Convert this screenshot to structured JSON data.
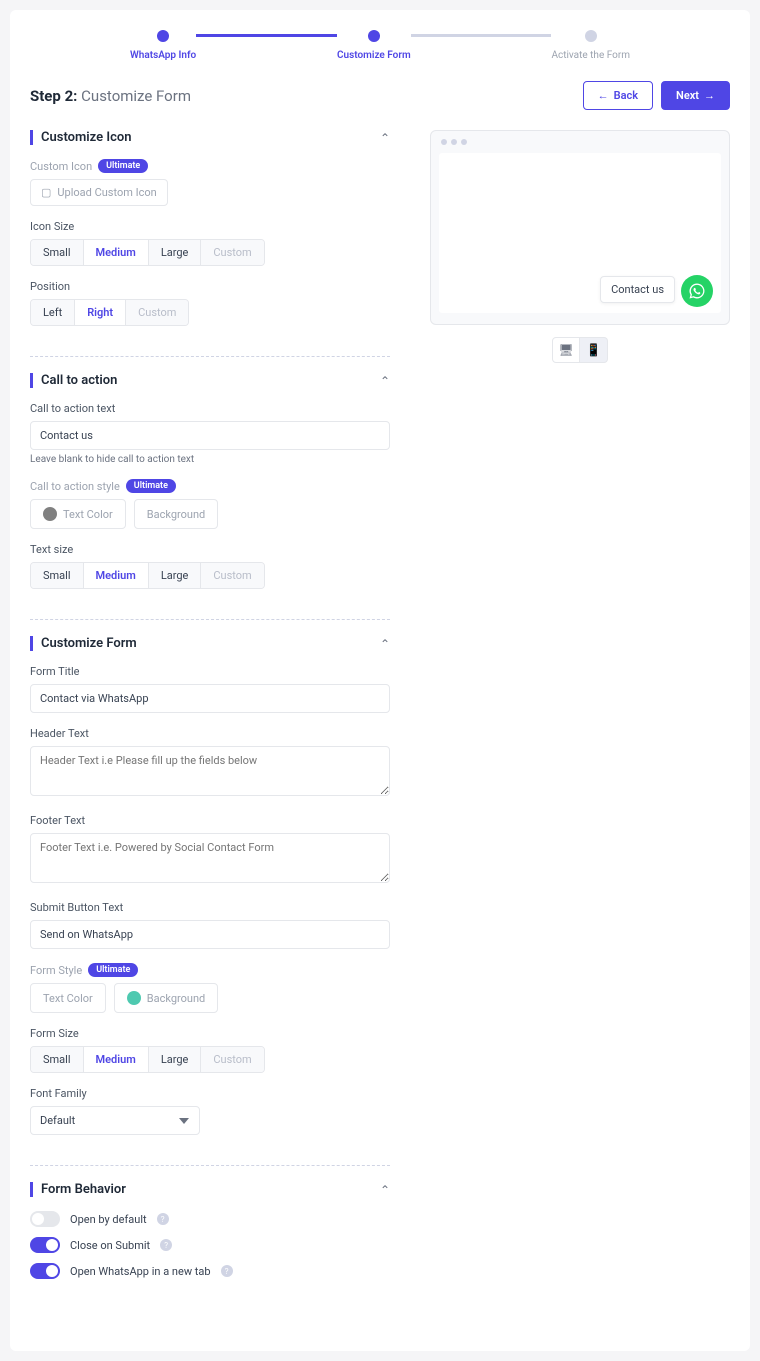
{
  "stepper": {
    "steps": [
      "WhatsApp Info",
      "Customize Form",
      "Activate the Form"
    ],
    "current": 1
  },
  "header": {
    "step_prefix": "Step 2:",
    "step_name": "Customize Form",
    "back": "Back",
    "next": "Next"
  },
  "customize_icon": {
    "title": "Customize Icon",
    "custom_icon_label": "Custom Icon",
    "ultimate": "Ultimate",
    "upload": "Upload Custom Icon",
    "icon_size_label": "Icon Size",
    "sizes": [
      "Small",
      "Medium",
      "Large",
      "Custom"
    ],
    "size_selected": "Medium",
    "position_label": "Position",
    "positions": [
      "Left",
      "Right",
      "Custom"
    ],
    "position_selected": "Right"
  },
  "call_to_action": {
    "title": "Call to action",
    "text_label": "Call to action text",
    "text_value": "Contact us",
    "text_hint": "Leave blank to hide call to action text",
    "style_label": "Call to action style",
    "text_color": "Text Color",
    "background": "Background",
    "text_color_hex": "#808080",
    "background_hex": "#ffffff",
    "text_size_label": "Text size",
    "sizes": [
      "Small",
      "Medium",
      "Large",
      "Custom"
    ],
    "size_selected": "Medium"
  },
  "customize_form": {
    "title": "Customize Form",
    "form_title_label": "Form Title",
    "form_title_value": "Contact via WhatsApp",
    "header_text_label": "Header Text",
    "header_text_placeholder": "Header Text i.e Please fill up the fields below",
    "footer_text_label": "Footer Text",
    "footer_text_placeholder": "Footer Text i.e. Powered by Social Contact Form",
    "submit_label": "Submit Button Text",
    "submit_value": "Send on WhatsApp",
    "form_style_label": "Form Style",
    "text_color": "Text Color",
    "background": "Background",
    "text_color_hex": "#ffffff",
    "background_hex": "#4ec9b0",
    "form_size_label": "Form Size",
    "sizes": [
      "Small",
      "Medium",
      "Large",
      "Custom"
    ],
    "size_selected": "Medium",
    "font_family_label": "Font Family",
    "font_family_value": "Default"
  },
  "form_behavior": {
    "title": "Form Behavior",
    "open_default": "Open by default",
    "open_default_on": false,
    "close_submit": "Close on Submit",
    "close_submit_on": true,
    "open_new_tab": "Open WhatsApp in a new tab",
    "open_new_tab_on": true
  },
  "preview": {
    "cta": "Contact us"
  }
}
